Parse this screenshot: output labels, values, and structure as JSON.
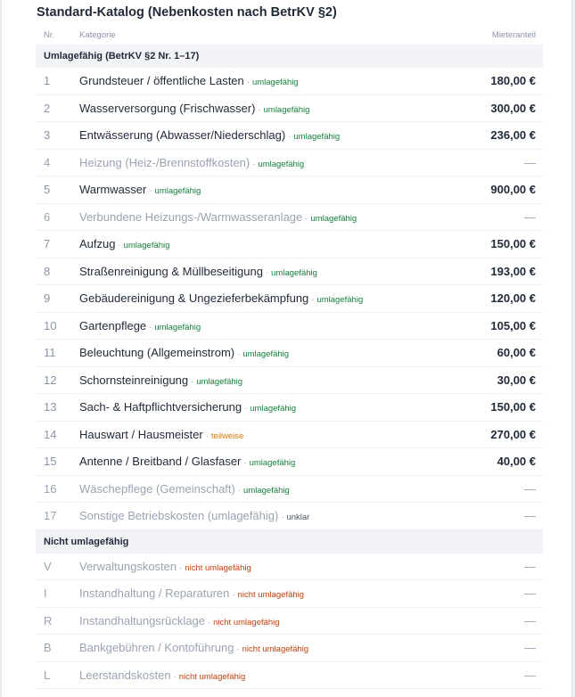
{
  "title": "Standard-Katalog (Nebenkosten nach BetrKV §2)",
  "columns": {
    "nr": "Nr.",
    "category": "Kategorie",
    "amount": "Mieteranteil"
  },
  "section_umlage": "Umlagefähig (BetrKV §2 Nr. 1–17)",
  "section_nicht": "Nicht umlagefähig",
  "separator": "·",
  "rows_umlage": [
    {
      "nr": "1",
      "cat": "Grundsteuer / öffentliche Lasten",
      "tag": "umlagefähig",
      "kind": "umlagefaehig",
      "amt": "180,00 €",
      "empty": false
    },
    {
      "nr": "2",
      "cat": "Wasserversorgung (Frischwasser)",
      "tag": "umlagefähig",
      "kind": "umlagefaehig",
      "amt": "300,00 €",
      "empty": false
    },
    {
      "nr": "3",
      "cat": "Entwässerung (Abwasser/Niederschlag)",
      "tag": "umlagefähig",
      "kind": "umlagefaehig",
      "amt": "236,00 €",
      "empty": false
    },
    {
      "nr": "4",
      "cat": "Heizung (Heiz-/Brennstoffkosten)",
      "tag": "umlagefähig",
      "kind": "umlagefaehig",
      "amt": "—",
      "empty": true
    },
    {
      "nr": "5",
      "cat": "Warmwasser",
      "tag": "umlagefähig",
      "kind": "umlagefaehig",
      "amt": "900,00 €",
      "empty": false
    },
    {
      "nr": "6",
      "cat": "Verbundene Heizungs-/Warmwasseranlage",
      "tag": "umlagefähig",
      "kind": "umlagefaehig",
      "amt": "—",
      "empty": true
    },
    {
      "nr": "7",
      "cat": "Aufzug",
      "tag": "umlagefähig",
      "kind": "umlagefaehig",
      "amt": "150,00 €",
      "empty": false
    },
    {
      "nr": "8",
      "cat": "Straßenreinigung & Müllbeseitigung",
      "tag": "umlagefähig",
      "kind": "umlagefaehig",
      "amt": "193,00 €",
      "empty": false
    },
    {
      "nr": "9",
      "cat": "Gebäudereinigung & Ungezieferbekämpfung",
      "tag": "umlagefähig",
      "kind": "umlagefaehig",
      "amt": "120,00 €",
      "empty": false
    },
    {
      "nr": "10",
      "cat": "Gartenpflege",
      "tag": "umlagefähig",
      "kind": "umlagefaehig",
      "amt": "105,00 €",
      "empty": false
    },
    {
      "nr": "11",
      "cat": "Beleuchtung (Allgemeinstrom)",
      "tag": "umlagefähig",
      "kind": "umlagefaehig",
      "amt": "60,00 €",
      "empty": false
    },
    {
      "nr": "12",
      "cat": "Schornsteinreinigung",
      "tag": "umlagefähig",
      "kind": "umlagefaehig",
      "amt": "30,00 €",
      "empty": false
    },
    {
      "nr": "13",
      "cat": "Sach- & Haftpflichtversicherung",
      "tag": "umlagefähig",
      "kind": "umlagefaehig",
      "amt": "150,00 €",
      "empty": false
    },
    {
      "nr": "14",
      "cat": "Hauswart / Hausmeister",
      "tag": "teilweise",
      "kind": "teilweise",
      "amt": "270,00 €",
      "empty": false
    },
    {
      "nr": "15",
      "cat": "Antenne / Breitband / Glasfaser",
      "tag": "umlagefähig",
      "kind": "umlagefaehig",
      "amt": "40,00 €",
      "empty": false
    },
    {
      "nr": "16",
      "cat": "Wäschepflege (Gemeinschaft)",
      "tag": "umlagefähig",
      "kind": "umlagefaehig",
      "amt": "—",
      "empty": true
    },
    {
      "nr": "17",
      "cat": "Sonstige Betriebskosten (umlagefähig)",
      "tag": "unklar",
      "kind": "unklar",
      "amt": "—",
      "empty": true
    }
  ],
  "rows_nicht": [
    {
      "nr": "V",
      "cat": "Verwaltungskosten",
      "tag": "nicht umlagefähig",
      "kind": "nicht",
      "amt": "—",
      "empty": true
    },
    {
      "nr": "I",
      "cat": "Instandhaltung / Reparaturen",
      "tag": "nicht umlagefähig",
      "kind": "nicht",
      "amt": "—",
      "empty": true
    },
    {
      "nr": "R",
      "cat": "Instandhaltungsrücklage",
      "tag": "nicht umlagefähig",
      "kind": "nicht",
      "amt": "—",
      "empty": true
    },
    {
      "nr": "B",
      "cat": "Bankgebühren / Kontoführung",
      "tag": "nicht umlagefähig",
      "kind": "nicht",
      "amt": "—",
      "empty": true
    },
    {
      "nr": "L",
      "cat": "Leerstandskosten",
      "tag": "nicht umlagefähig",
      "kind": "nicht",
      "amt": "—",
      "empty": true
    }
  ],
  "colors": {
    "umlagefaehig": "#15803d",
    "teilweise": "#d97706",
    "unklar": "#4b5563",
    "nicht": "#c2410c"
  }
}
